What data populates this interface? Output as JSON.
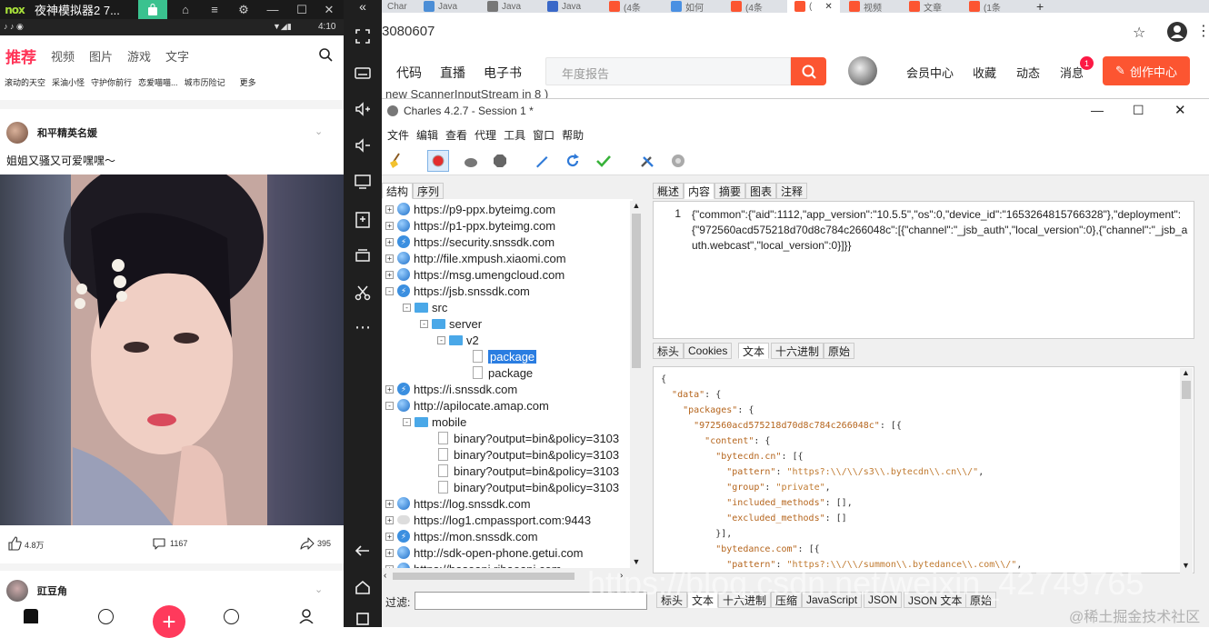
{
  "emulator": {
    "title": "夜神模拟器2 7...",
    "status_time": "4:10",
    "app": {
      "tabs": [
        "推荐",
        "视频",
        "图片",
        "游戏",
        "文字"
      ],
      "subcats": [
        "滚动的天空",
        "采油小怪",
        "守护你前行",
        "恋爱喵喵...",
        "城市历险记",
        "更多"
      ],
      "post1": {
        "author": "和平精英名媛",
        "text": "姐姐又骚又可爱嘿嘿～",
        "likes": "4.8万",
        "comments": "1167",
        "shares": "395"
      },
      "post2": {
        "author": "豇豆角"
      }
    }
  },
  "browser": {
    "tabs": [
      "Char",
      "Java",
      "Java",
      "Java",
      "(4条",
      "如何",
      "(4条",
      "(",
      "视频",
      "文章",
      "(1条"
    ],
    "url": "3080607",
    "site_nav": [
      "代码",
      "直播",
      "电子书"
    ],
    "search_placeholder": "年度报告",
    "user_links": [
      "会员中心",
      "收藏",
      "动态",
      "消息"
    ],
    "message_badge": "1",
    "create_button": "创作中心",
    "behind_text": "new ScannerInputStream  in 8 )"
  },
  "charles": {
    "title": "Charles 4.2.7 - Session 1 *",
    "menu": [
      "文件",
      "编辑",
      "查看",
      "代理",
      "工具",
      "窗口",
      "帮助"
    ],
    "tree_tabs": [
      "结构",
      "序列"
    ],
    "tree": [
      {
        "indent": 0,
        "exp": "+",
        "icon": "globe",
        "label": "https://p9-ppx.byteimg.com"
      },
      {
        "indent": 0,
        "exp": "+",
        "icon": "globe",
        "label": "https://p1-ppx.byteimg.com"
      },
      {
        "indent": 0,
        "exp": "+",
        "icon": "bolt",
        "label": "https://security.snssdk.com"
      },
      {
        "indent": 0,
        "exp": "+",
        "icon": "globe",
        "label": "http://file.xmpush.xiaomi.com"
      },
      {
        "indent": 0,
        "exp": "+",
        "icon": "globe",
        "label": "https://msg.umengcloud.com"
      },
      {
        "indent": 0,
        "exp": "-",
        "icon": "bolt",
        "label": "https://jsb.snssdk.com"
      },
      {
        "indent": 1,
        "exp": "-",
        "icon": "folder",
        "label": "src"
      },
      {
        "indent": 2,
        "exp": "-",
        "icon": "folder",
        "label": "server"
      },
      {
        "indent": 3,
        "exp": "-",
        "icon": "folder",
        "label": "v2"
      },
      {
        "indent": 4,
        "exp": "",
        "icon": "file",
        "label": "package",
        "selected": true
      },
      {
        "indent": 4,
        "exp": "",
        "icon": "file",
        "label": "package"
      },
      {
        "indent": 0,
        "exp": "+",
        "icon": "bolt",
        "label": "https://i.snssdk.com"
      },
      {
        "indent": 0,
        "exp": "-",
        "icon": "globe",
        "label": "http://apilocate.amap.com"
      },
      {
        "indent": 1,
        "exp": "-",
        "icon": "folder",
        "label": "mobile"
      },
      {
        "indent": 2,
        "exp": "",
        "icon": "file",
        "label": "binary?output=bin&policy=3103"
      },
      {
        "indent": 2,
        "exp": "",
        "icon": "file",
        "label": "binary?output=bin&policy=3103"
      },
      {
        "indent": 2,
        "exp": "",
        "icon": "file",
        "label": "binary?output=bin&policy=3103"
      },
      {
        "indent": 2,
        "exp": "",
        "icon": "file",
        "label": "binary?output=bin&policy=3103"
      },
      {
        "indent": 0,
        "exp": "+",
        "icon": "globe",
        "label": "https://log.snssdk.com"
      },
      {
        "indent": 0,
        "exp": "+",
        "icon": "cloud",
        "label": "https://log1.cmpassport.com:9443"
      },
      {
        "indent": 0,
        "exp": "+",
        "icon": "bolt",
        "label": "https://mon.snssdk.com"
      },
      {
        "indent": 0,
        "exp": "+",
        "icon": "globe",
        "label": "http://sdk-open-phone.getui.com"
      },
      {
        "indent": 0,
        "exp": "+",
        "icon": "globe",
        "label": "https://baseapi.ribaoapi.com"
      }
    ],
    "filter_label": "过滤:",
    "top_tabs": [
      "概述",
      "内容",
      "摘要",
      "图表",
      "注释"
    ],
    "request_line_no": "1",
    "request_body": "{\"common\":{\"aid\":1112,\"app_version\":\"10.5.5\",\"os\":0,\"device_id\":\"1653264815766328\"},\"deployment\":{\"972560acd575218d70d8c784c266048c\":[{\"channel\":\"_jsb_auth\",\"local_version\":0},{\"channel\":\"_jsb_auth.webcast\",\"local_version\":0}]}}",
    "mid_tabs": [
      "标头",
      "Cookies",
      "文本",
      "十六进制",
      "原始"
    ],
    "response_lines": [
      "{",
      "  \"data\": {",
      "    \"packages\": {",
      "      \"972560acd575218d70d8c784c266048c\": [{",
      "        \"content\": {",
      "          \"bytecdn.cn\": [{",
      "            \"pattern\": \"https?:\\\\/\\\\/s3\\\\.bytecdn\\\\.cn\\\\/\",",
      "            \"group\": \"private\",",
      "            \"included_methods\": [],",
      "            \"excluded_methods\": []",
      "          }],",
      "          \"bytedance.com\": [{",
      "            \"pattern\": \"https?:\\\\/\\\\/summon\\\\.bytedance\\\\.com\\\\/\","
    ],
    "bottom_tabs": [
      "标头",
      "文本",
      "十六进制",
      "压缩",
      "JavaScript",
      "JSON",
      "JSON 文本",
      "原始"
    ]
  },
  "watermark": "https://blog.csdn.net/weixin_42749765",
  "watermark2": "@稀土掘金技术社区"
}
